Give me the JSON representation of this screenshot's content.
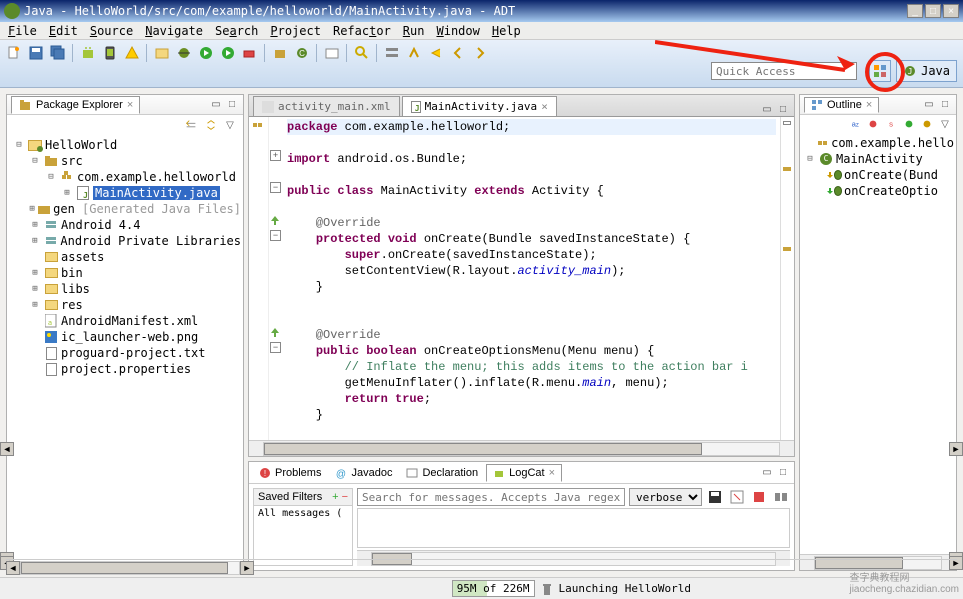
{
  "window": {
    "title": "Java - HelloWorld/src/com/example/helloworld/MainActivity.java - ADT"
  },
  "menu": {
    "items": [
      "File",
      "Edit",
      "Source",
      "Navigate",
      "Search",
      "Project",
      "Refactor",
      "Run",
      "Window",
      "Help"
    ]
  },
  "quick_access": {
    "placeholder": "Quick Access"
  },
  "perspective": {
    "java": "Java"
  },
  "package_explorer": {
    "title": "Package Explorer",
    "tree": {
      "project": "HelloWorld",
      "src": "src",
      "pkg": "com.example.helloworld",
      "main": "MainActivity.java",
      "gen": "gen",
      "gen_note": "[Generated Java Files]",
      "android44": "Android 4.4",
      "apl": "Android Private Libraries",
      "assets": "assets",
      "bin": "bin",
      "libs": "libs",
      "res": "res",
      "manifest": "AndroidManifest.xml",
      "launcher": "ic_launcher-web.png",
      "proguard": "proguard-project.txt",
      "props": "project.properties"
    }
  },
  "editor": {
    "tab_inactive": "activity_main.xml",
    "tab_active": "MainActivity.java",
    "code": {
      "l1a": "package",
      "l1b": " com.example.helloworld;",
      "l3a": "import",
      "l3b": " android.os.Bundle;",
      "l5a": "public class",
      "l5b": " MainActivity ",
      "l5c": "extends",
      "l5d": " Activity {",
      "l7": "    @Override",
      "l8a": "    ",
      "l8b": "protected void",
      "l8c": " onCreate(Bundle savedInstanceState) {",
      "l9a": "        ",
      "l9b": "super",
      "l9c": ".onCreate(savedInstanceState);",
      "l10a": "        setContentView(R.layout.",
      "l10b": "activity_main",
      "l10c": ");",
      "l11": "    }",
      "l14": "    @Override",
      "l15a": "    ",
      "l15b": "public boolean",
      "l15c": " onCreateOptionsMenu(Menu menu) {",
      "l16": "        // Inflate the menu; this adds items to the action bar i",
      "l17a": "        getMenuInflater().inflate(R.menu.",
      "l17b": "main",
      "l17c": ", menu);",
      "l18a": "        ",
      "l18b": "return true",
      "l18c": ";",
      "l19": "    }"
    }
  },
  "outline": {
    "title": "Outline",
    "pkg": "com.example.hello",
    "cls": "MainActivity",
    "m1": "onCreate(Bund",
    "m2": "onCreateOptio"
  },
  "bottom": {
    "tabs": {
      "problems": "Problems",
      "javadoc": "Javadoc",
      "declaration": "Declaration",
      "logcat": "LogCat"
    },
    "saved_filters": "Saved Filters",
    "all_messages": "All messages (",
    "search_placeholder": "Search for messages. Accepts Java regexes. Prefix with pid:, ap",
    "verbose": "verbose"
  },
  "status": {
    "mem": "95M of 226M",
    "msg": "Launching HelloWorld"
  },
  "watermark": "查字典教程网\njiaocheng.chazidian.com"
}
